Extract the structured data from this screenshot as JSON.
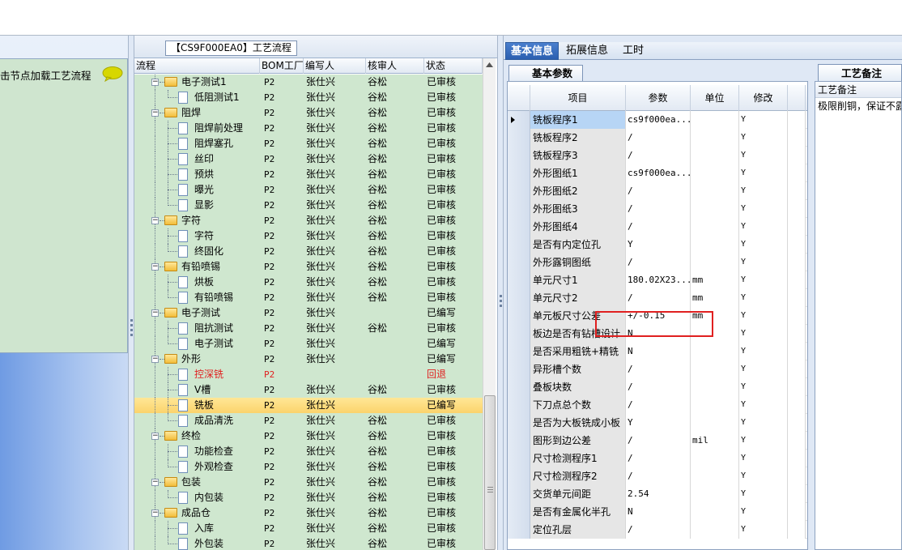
{
  "left": {
    "hint": "击节点加载工艺流程"
  },
  "center": {
    "title": "【CS9F000EA0】工艺流程",
    "columns": [
      "流程",
      "BOM工厂",
      "编写人",
      "核审人",
      "状态"
    ],
    "rows": [
      {
        "level": 1,
        "type": "folder",
        "name": "电子测试1",
        "factory": "P2",
        "writer": "张仕兴",
        "reviewer": "谷松",
        "status": "已审核"
      },
      {
        "level": 2,
        "type": "doc",
        "name": "低阻测试1",
        "factory": "P2",
        "writer": "张仕兴",
        "reviewer": "谷松",
        "status": "已审核"
      },
      {
        "level": 1,
        "type": "folder",
        "name": "阻焊",
        "factory": "P2",
        "writer": "张仕兴",
        "reviewer": "谷松",
        "status": "已审核"
      },
      {
        "level": 2,
        "type": "doc",
        "name": "阻焊前处理",
        "factory": "P2",
        "writer": "张仕兴",
        "reviewer": "谷松",
        "status": "已审核"
      },
      {
        "level": 2,
        "type": "doc",
        "name": "阻焊塞孔",
        "factory": "P2",
        "writer": "张仕兴",
        "reviewer": "谷松",
        "status": "已审核"
      },
      {
        "level": 2,
        "type": "doc",
        "name": "丝印",
        "factory": "P2",
        "writer": "张仕兴",
        "reviewer": "谷松",
        "status": "已审核"
      },
      {
        "level": 2,
        "type": "doc",
        "name": "预烘",
        "factory": "P2",
        "writer": "张仕兴",
        "reviewer": "谷松",
        "status": "已审核"
      },
      {
        "level": 2,
        "type": "doc",
        "name": "曝光",
        "factory": "P2",
        "writer": "张仕兴",
        "reviewer": "谷松",
        "status": "已审核"
      },
      {
        "level": 2,
        "type": "doc",
        "name": "显影",
        "factory": "P2",
        "writer": "张仕兴",
        "reviewer": "谷松",
        "status": "已审核"
      },
      {
        "level": 1,
        "type": "folder",
        "name": "字符",
        "factory": "P2",
        "writer": "张仕兴",
        "reviewer": "谷松",
        "status": "已审核"
      },
      {
        "level": 2,
        "type": "doc",
        "name": "字符",
        "factory": "P2",
        "writer": "张仕兴",
        "reviewer": "谷松",
        "status": "已审核"
      },
      {
        "level": 2,
        "type": "doc",
        "name": "终固化",
        "factory": "P2",
        "writer": "张仕兴",
        "reviewer": "谷松",
        "status": "已审核"
      },
      {
        "level": 1,
        "type": "folder",
        "name": "有铅喷锡",
        "factory": "P2",
        "writer": "张仕兴",
        "reviewer": "谷松",
        "status": "已审核"
      },
      {
        "level": 2,
        "type": "doc",
        "name": "烘板",
        "factory": "P2",
        "writer": "张仕兴",
        "reviewer": "谷松",
        "status": "已审核"
      },
      {
        "level": 2,
        "type": "doc",
        "name": "有铅喷锡",
        "factory": "P2",
        "writer": "张仕兴",
        "reviewer": "谷松",
        "status": "已审核"
      },
      {
        "level": 1,
        "type": "folder",
        "name": "电子测试",
        "factory": "P2",
        "writer": "张仕兴",
        "reviewer": "",
        "status": "已编写"
      },
      {
        "level": 2,
        "type": "doc",
        "name": "阻抗测试",
        "factory": "P2",
        "writer": "张仕兴",
        "reviewer": "谷松",
        "status": "已审核"
      },
      {
        "level": 2,
        "type": "doc",
        "name": "电子测试",
        "factory": "P2",
        "writer": "张仕兴",
        "reviewer": "",
        "status": "已编写"
      },
      {
        "level": 1,
        "type": "folder",
        "name": "外形",
        "factory": "P2",
        "writer": "张仕兴",
        "reviewer": "",
        "status": "已编写"
      },
      {
        "level": 2,
        "type": "doc",
        "name": "控深铣",
        "factory": "P2",
        "writer": "",
        "reviewer": "",
        "status": "回退",
        "red": true
      },
      {
        "level": 2,
        "type": "doc",
        "name": "V槽",
        "factory": "P2",
        "writer": "张仕兴",
        "reviewer": "谷松",
        "status": "已审核"
      },
      {
        "level": 2,
        "type": "doc",
        "name": "铣板",
        "factory": "P2",
        "writer": "张仕兴",
        "reviewer": "",
        "status": "已编写",
        "selected": true
      },
      {
        "level": 2,
        "type": "doc",
        "name": "成品清洗",
        "factory": "P2",
        "writer": "张仕兴",
        "reviewer": "谷松",
        "status": "已审核"
      },
      {
        "level": 1,
        "type": "folder",
        "name": "终检",
        "factory": "P2",
        "writer": "张仕兴",
        "reviewer": "谷松",
        "status": "已审核"
      },
      {
        "level": 2,
        "type": "doc",
        "name": "功能检查",
        "factory": "P2",
        "writer": "张仕兴",
        "reviewer": "谷松",
        "status": "已审核"
      },
      {
        "level": 2,
        "type": "doc",
        "name": "外观检查",
        "factory": "P2",
        "writer": "张仕兴",
        "reviewer": "谷松",
        "status": "已审核"
      },
      {
        "level": 1,
        "type": "folder",
        "name": "包装",
        "factory": "P2",
        "writer": "张仕兴",
        "reviewer": "谷松",
        "status": "已审核"
      },
      {
        "level": 2,
        "type": "doc",
        "name": "内包装",
        "factory": "P2",
        "writer": "张仕兴",
        "reviewer": "谷松",
        "status": "已审核"
      },
      {
        "level": 1,
        "type": "folder",
        "name": "成品仓",
        "factory": "P2",
        "writer": "张仕兴",
        "reviewer": "谷松",
        "status": "已审核"
      },
      {
        "level": 2,
        "type": "doc",
        "name": "入库",
        "factory": "P2",
        "writer": "张仕兴",
        "reviewer": "谷松",
        "status": "已审核"
      },
      {
        "level": 2,
        "type": "doc",
        "name": "外包装",
        "factory": "P2",
        "writer": "张仕兴",
        "reviewer": "谷松",
        "status": "已审核"
      }
    ]
  },
  "right": {
    "tabs": [
      "基本信息",
      "拓展信息",
      "工时"
    ],
    "subtab": "基本参数",
    "columns": [
      "项目",
      "参数",
      "单位",
      "修改"
    ],
    "params": [
      {
        "item": "铣板程序1",
        "value": "cs9f000ea...",
        "unit": "",
        "mod": "Y",
        "selected": true
      },
      {
        "item": "铣板程序2",
        "value": "/",
        "unit": "",
        "mod": "Y"
      },
      {
        "item": "铣板程序3",
        "value": "/",
        "unit": "",
        "mod": "Y"
      },
      {
        "item": "外形图纸1",
        "value": "cs9f000ea...",
        "unit": "",
        "mod": "Y"
      },
      {
        "item": "外形图纸2",
        "value": "/",
        "unit": "",
        "mod": "Y"
      },
      {
        "item": "外形图纸3",
        "value": "/",
        "unit": "",
        "mod": "Y"
      },
      {
        "item": "外形图纸4",
        "value": "/",
        "unit": "",
        "mod": "Y"
      },
      {
        "item": "是否有内定位孔",
        "value": "Y",
        "unit": "",
        "mod": "Y"
      },
      {
        "item": "外形露铜图纸",
        "value": "/",
        "unit": "",
        "mod": "Y"
      },
      {
        "item": "单元尺寸1",
        "value": "180.02X23...",
        "unit": "mm",
        "mod": "Y"
      },
      {
        "item": "单元尺寸2",
        "value": "/",
        "unit": "mm",
        "mod": "Y"
      },
      {
        "item": "单元板尺寸公差",
        "value": "+/-0.15",
        "unit": "mm",
        "mod": "Y"
      },
      {
        "item": "板边是否有钻槽设计",
        "value": "N",
        "unit": "",
        "mod": "Y"
      },
      {
        "item": "是否采用粗铣+精铣",
        "value": "N",
        "unit": "",
        "mod": "Y"
      },
      {
        "item": "异形槽个数",
        "value": "/",
        "unit": "",
        "mod": "Y"
      },
      {
        "item": "叠板块数",
        "value": "/",
        "unit": "",
        "mod": "Y"
      },
      {
        "item": "下刀点总个数",
        "value": "/",
        "unit": "",
        "mod": "Y"
      },
      {
        "item": "是否为大板铣成小板",
        "value": "Y",
        "unit": "",
        "mod": "Y"
      },
      {
        "item": "图形到边公差",
        "value": "/",
        "unit": "mil",
        "mod": "Y"
      },
      {
        "item": "尺寸检测程序1",
        "value": "/",
        "unit": "",
        "mod": "Y"
      },
      {
        "item": "尺寸检测程序2",
        "value": "/",
        "unit": "",
        "mod": "Y"
      },
      {
        "item": "交货单元间距",
        "value": "2.54",
        "unit": "",
        "mod": "Y"
      },
      {
        "item": "是否有金属化半孔",
        "value": "N",
        "unit": "",
        "mod": "Y"
      },
      {
        "item": "定位孔层",
        "value": "/",
        "unit": "",
        "mod": "Y"
      }
    ],
    "notes": {
      "tab": "工艺备注",
      "header": "工艺备注",
      "text": "极限削铜，保证不露"
    }
  }
}
